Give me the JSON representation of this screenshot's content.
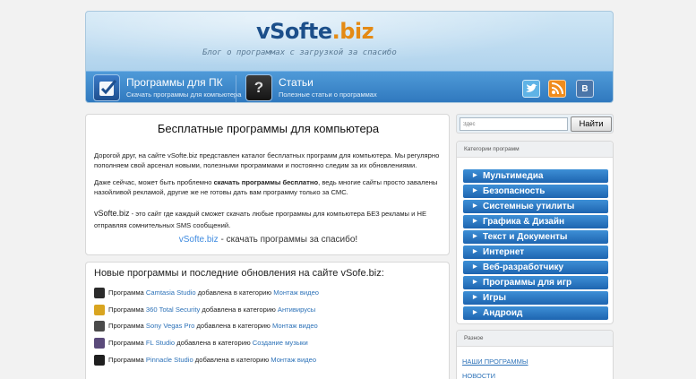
{
  "header": {
    "logo_main": "vSofte",
    "logo_ext": ".biz",
    "slogan": "Блог о программах с загрузкой за спасибо",
    "nav": [
      {
        "title": "Программы для ПК",
        "subtitle": "Скачать программы для компьютера"
      },
      {
        "title": "Статьи",
        "subtitle": "Полезные статьи о программах"
      }
    ],
    "social": [
      "twitter-icon",
      "rss-icon",
      "vk-icon"
    ],
    "vk_label": "В"
  },
  "intro": {
    "title": "Бесплатные программы для компьютера",
    "p1": "Дорогой друг, на сайте vSofte.biz представлен каталог бесплатных программ для компьютера. Мы регулярно пополняем свой арсенал новыми, полезными программами и постоянно следим за их обновлениями.",
    "p2_before": "Даже сейчас, может быть проблемно ",
    "p2_bold": "скачать программы бесплатно",
    "p2_after": ", ведь многие сайты просто завалены назойливой рекламой, другие же не готовы дать вам программу только за СМС.",
    "p3_brand": "vSofte.biz",
    "p3_text": " - это сайт где каждый сможет скачать любые программы для компьютера БЕЗ рекламы и НЕ отправляя сомнительных SMS сообщений.",
    "tagline_site": "vSofte.biz",
    "tagline_text": " - скачать программы за спасибо!"
  },
  "updates": {
    "title": "Новые программы и последние обновления на сайте vSofe.biz:",
    "word_program": "Программа ",
    "rows": [
      {
        "name": "Camtasia Studio",
        "verb": " добавлена в категорию ",
        "category": "Монтаж видео",
        "thumb_color": "#2b2b2b"
      },
      {
        "name": "360 Total Security",
        "verb": " добавлена в категорию ",
        "category": "Антивирусы",
        "thumb_color": "#d9a520"
      },
      {
        "name": "Sony Vegas Pro",
        "verb": " добавлена в категорию ",
        "category": "Монтаж видео",
        "thumb_color": "#4a4a4a"
      },
      {
        "name": "FL Studio",
        "verb": " добавлена в категорию ",
        "category": "Создание музыки",
        "thumb_color": "#5a4a7a"
      },
      {
        "name": "Pinnacle Studio",
        "verb": " добавлена в категорию ",
        "category": "Монтаж видео",
        "thumb_color": "#1f1f1f"
      }
    ]
  },
  "search": {
    "placeholder": "Здес",
    "button": "Найти"
  },
  "categories": {
    "title": "Категории программ",
    "items": [
      "Мультимедиа",
      "Безопасность",
      "Системные утилиты",
      "Графика & Дизайн",
      "Текст и Документы",
      "Интернет",
      "Веб-разработчику",
      "Программы для игр",
      "Игры",
      "Андроид"
    ]
  },
  "misc": {
    "title": "Разное",
    "links": [
      "НАШИ ПРОГРАММЫ",
      "НОВОСТИ"
    ]
  }
}
